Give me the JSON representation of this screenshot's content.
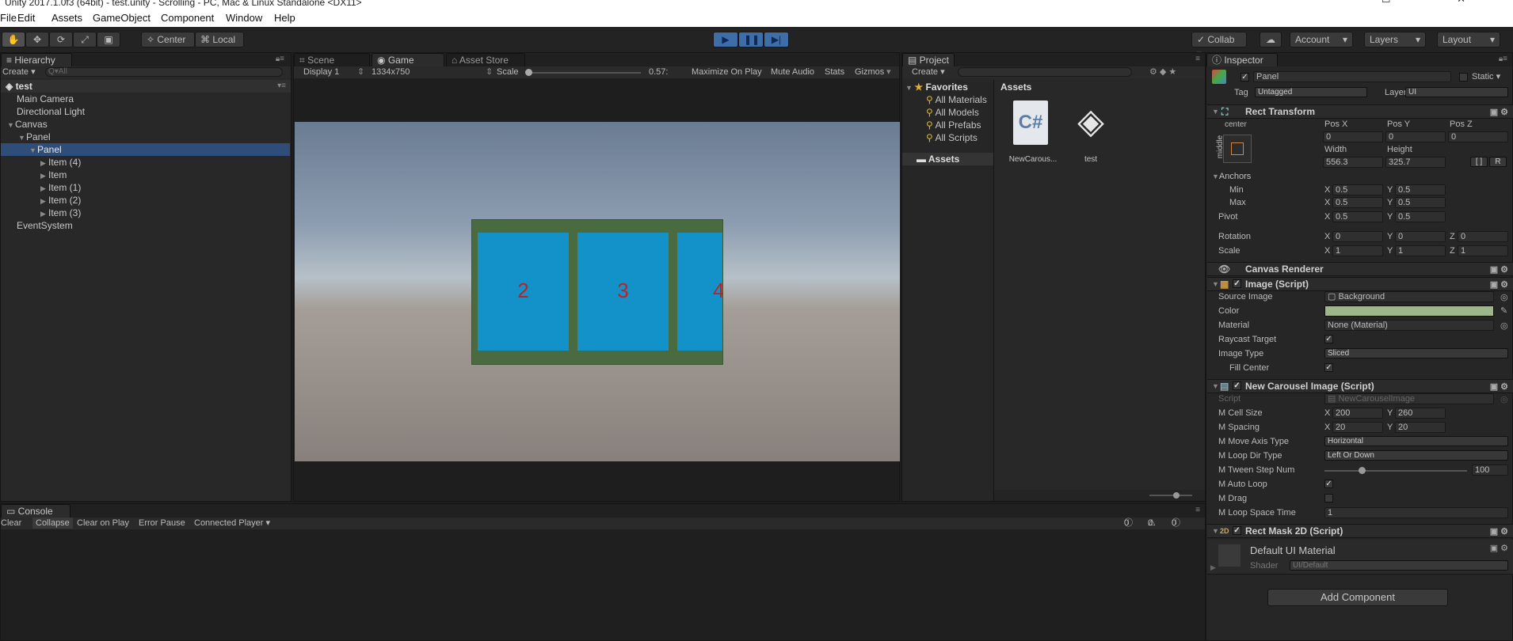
{
  "window": {
    "title": "Unity 2017.1.0f3 (64bit) - test.unity - Scrolling - PC, Mac & Linux Standalone <DX11>",
    "controls": "— ☐ ✕"
  },
  "menu": [
    "File",
    "Edit",
    "Assets",
    "GameObject",
    "Component",
    "Window",
    "Help"
  ],
  "toolbar": {
    "center": "Center",
    "local": "Local",
    "collab": "Collab ▾",
    "account": "Account",
    "layers": "Layers",
    "layout": "Layout"
  },
  "hierarchy": {
    "tab": "Hierarchy",
    "create": "Create ▾",
    "search_placeholder": "Q▾All",
    "scene": "test",
    "items": [
      "Main Camera",
      "Directional Light",
      "Canvas",
      "Panel",
      "Panel",
      "Item (4)",
      "Item",
      "Item (1)",
      "Item (2)",
      "Item (3)",
      "EventSystem"
    ]
  },
  "scene_view": {
    "tabs": [
      "Scene",
      "Game",
      "Asset Store"
    ],
    "display": "Display 1",
    "resolution": "1334x750",
    "scale_label": "Scale",
    "scale_value": "0.57:",
    "maximize": "Maximize On Play",
    "mute": "Mute Audio",
    "stats": "Stats",
    "gizmos": "Gizmos",
    "cells": [
      "2",
      "3",
      "4"
    ],
    "colors": {
      "panel": "#4a6b3f",
      "cell": "#1392c9",
      "number": "#c02020"
    }
  },
  "project": {
    "tab": "Project",
    "create": "Create ▾",
    "favorites": "Favorites",
    "fav_items": [
      "All Materials",
      "All Models",
      "All Prefabs",
      "All Scripts"
    ],
    "assets_tree": "Assets",
    "assets_header": "Assets",
    "files": [
      {
        "name": "NewCarous...",
        "icon": "csharp-script-icon"
      },
      {
        "name": "test",
        "icon": "unity-scene-icon"
      }
    ]
  },
  "console": {
    "tab": "Console",
    "buttons": [
      "Clear",
      "Collapse",
      "Clear on Play",
      "Error Pause",
      "Connected Player ▾"
    ],
    "counts": [
      "0",
      "0",
      "0"
    ]
  },
  "inspector": {
    "tab": "Inspector",
    "name": "Panel",
    "static": "Static ▾",
    "tag_label": "Tag",
    "tag_value": "Untagged",
    "layer_label": "Layer",
    "layer_value": "UI",
    "rect_transform": {
      "title": "Rect Transform",
      "anchor_h": "center",
      "anchor_v": "middle",
      "pos_x_label": "Pos X",
      "pos_y_label": "Pos Y",
      "pos_z_label": "Pos Z",
      "pos_x": "0",
      "pos_y": "0",
      "pos_z": "0",
      "width_label": "Width",
      "height_label": "Height",
      "width": "556.3",
      "height": "325.7",
      "btn_blueprint": "[ ]",
      "btn_r": "R",
      "anchors": "Anchors",
      "min": "Min",
      "max": "Max",
      "pivot": "Pivot",
      "min_x": "0.5",
      "min_y": "0.5",
      "max_x": "0.5",
      "max_y": "0.5",
      "pivot_x": "0.5",
      "pivot_y": "0.5",
      "rotation": "Rotation",
      "rot_x": "0",
      "rot_y": "0",
      "rot_z": "0",
      "scale": "Scale",
      "scale_x": "1",
      "scale_y": "1",
      "scale_z": "1",
      "x": "X",
      "y": "Y",
      "z": "Z"
    },
    "canvas_renderer": "Canvas Renderer",
    "image": {
      "title": "Image (Script)",
      "source_label": "Source Image",
      "source": "Background",
      "color_label": "Color",
      "color": "#9db78a",
      "material_label": "Material",
      "material": "None (Material)",
      "raycast_label": "Raycast Target",
      "type_label": "Image Type",
      "type": "Sliced",
      "fill_label": "Fill Center"
    },
    "carousel": {
      "title": "New Carousel Image (Script)",
      "script_label": "Script",
      "script": "NewCarouselImage",
      "cell_size_label": "M Cell Size",
      "cell_x": "200",
      "cell_y": "260",
      "spacing_label": "M Spacing",
      "spacing_x": "20",
      "spacing_y": "20",
      "move_axis_label": "M Move Axis Type",
      "move_axis": "Horizontal",
      "loop_dir_label": "M Loop Dir Type",
      "loop_dir": "Left Or Down",
      "tween_label": "M Tween Step Num",
      "tween": "100",
      "tween_level": 0.25,
      "auto_loop_label": "M Auto Loop",
      "drag_label": "M Drag",
      "loop_space_label": "M Loop Space Time",
      "loop_space": "1"
    },
    "rect_mask": "Rect Mask 2D (Script)",
    "material": {
      "name": "Default UI Material",
      "shader_label": "Shader",
      "shader": "UI/Default"
    },
    "add_component": "Add Component"
  }
}
